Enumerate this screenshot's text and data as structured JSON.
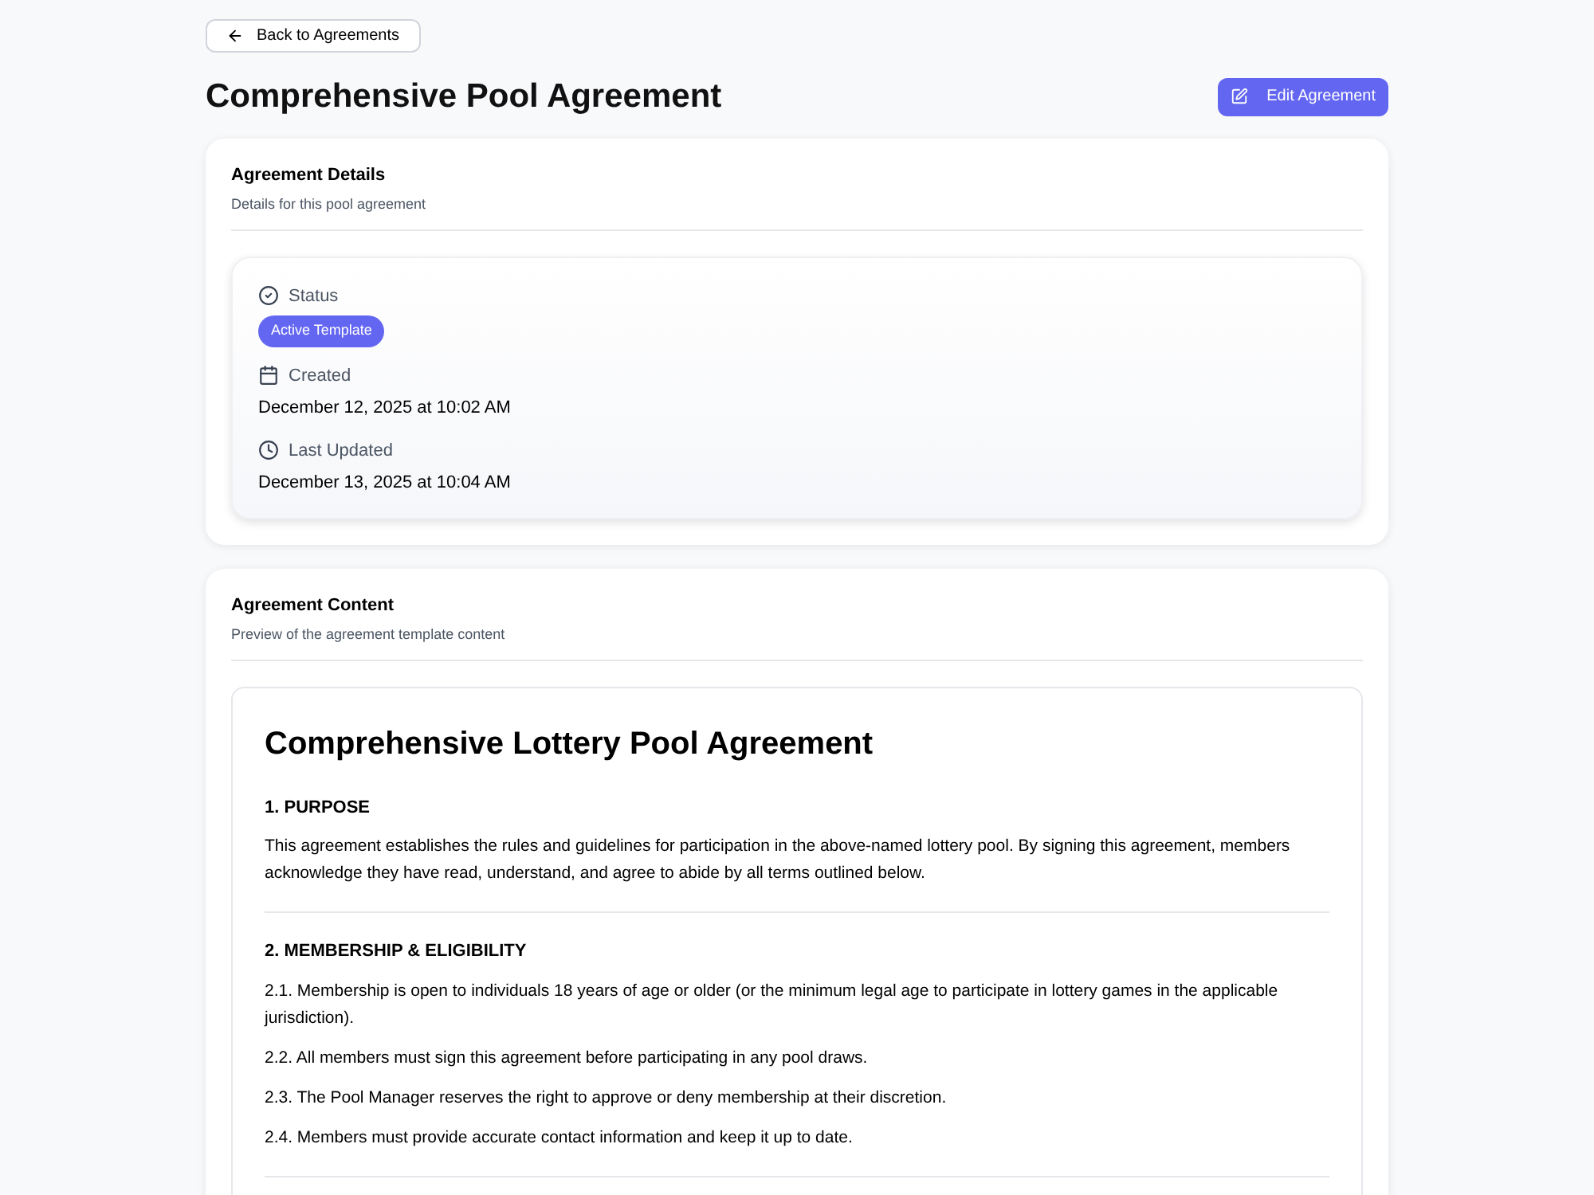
{
  "back_button": "Back to Agreements",
  "title": "Comprehensive Pool Agreement",
  "edit_button": "Edit Agreement",
  "details": {
    "title": "Agreement Details",
    "subtitle": "Details for this pool agreement",
    "fields": [
      {
        "kind": "status",
        "label": "Status",
        "badge": "Active Template"
      },
      {
        "kind": "created",
        "label": "Created",
        "value": "December 12, 2025 at 10:02 AM"
      },
      {
        "kind": "updated",
        "label": "Last Updated",
        "value": "December 13, 2025 at 10:04 AM"
      }
    ]
  },
  "content": {
    "title": "Agreement Content",
    "subtitle": "Preview of the agreement template content",
    "document": {
      "heading": "Comprehensive Lottery Pool Agreement",
      "sections": [
        {
          "heading": "1. PURPOSE",
          "paragraphs": [
            "This agreement establishes the rules and guidelines for participation in the above-named lottery pool. By signing this agreement, members acknowledge they have read, understand, and agree to abide by all terms outlined below."
          ]
        },
        {
          "heading": "2. MEMBERSHIP & ELIGIBILITY",
          "paragraphs": [
            "2.1. Membership is open to individuals 18 years of age or older (or the minimum legal age to participate in lottery games in the applicable jurisdiction).",
            "2.2. All members must sign this agreement before participating in any pool draws.",
            "2.3. The Pool Manager reserves the right to approve or deny membership at their discretion.",
            "2.4. Members must provide accurate contact information and keep it up to date."
          ]
        }
      ]
    }
  }
}
